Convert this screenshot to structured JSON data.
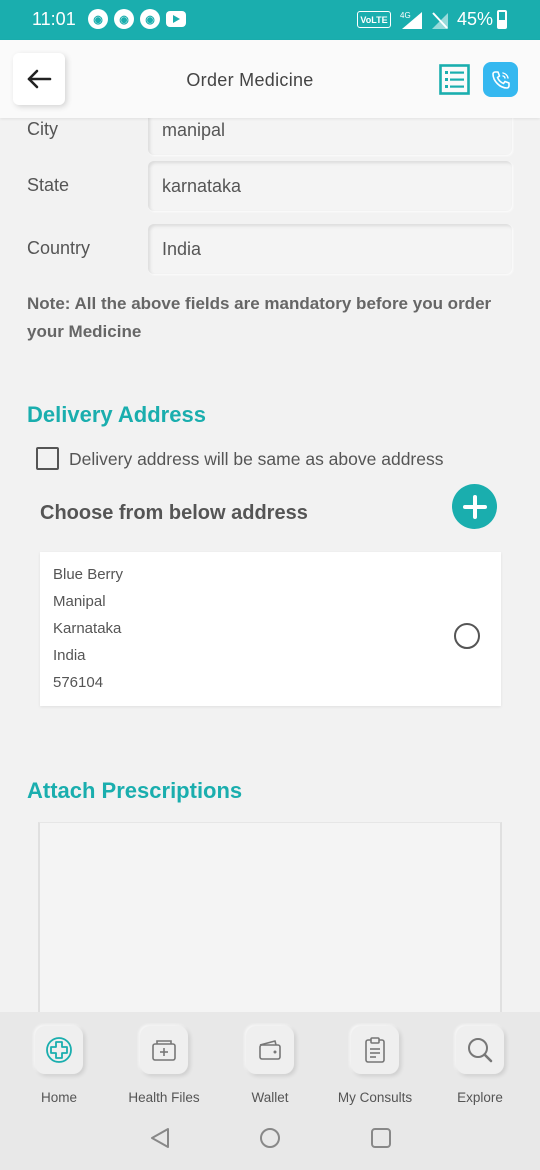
{
  "status_bar": {
    "time": "11:01",
    "volte": "VoLTE",
    "network": "4G",
    "battery": "45%"
  },
  "header": {
    "title": "Order Medicine",
    "icons": {
      "back": "back-arrow-icon",
      "list": "list-icon",
      "call": "phone-icon"
    }
  },
  "form": {
    "city": {
      "label": "City",
      "value": "manipal"
    },
    "state": {
      "label": "State",
      "value": "karnataka"
    },
    "country": {
      "label": "Country",
      "value": "India"
    },
    "note": "Note: All the above fields are mandatory before you order your Medicine"
  },
  "delivery": {
    "heading": "Delivery Address",
    "same_address_label": "Delivery address will be same as above address",
    "same_address_checked": false,
    "choose_label": "Choose from below address",
    "addresses": [
      {
        "lines": [
          "Blue Berry",
          "Manipal",
          "Karnataka",
          "India",
          "576104"
        ],
        "selected": false
      }
    ]
  },
  "prescriptions": {
    "heading": "Attach Prescriptions"
  },
  "bottom_nav": {
    "items": [
      {
        "label": "Home",
        "icon": "home-plus-icon"
      },
      {
        "label": "Health Files",
        "icon": "health-files-icon"
      },
      {
        "label": "Wallet",
        "icon": "wallet-icon"
      },
      {
        "label": "My Consults",
        "icon": "clipboard-icon"
      },
      {
        "label": "Explore",
        "icon": "search-icon"
      }
    ]
  },
  "colors": {
    "accent": "#1aaeae",
    "call_button": "#35b8f0",
    "background": "#f2f2f2"
  }
}
